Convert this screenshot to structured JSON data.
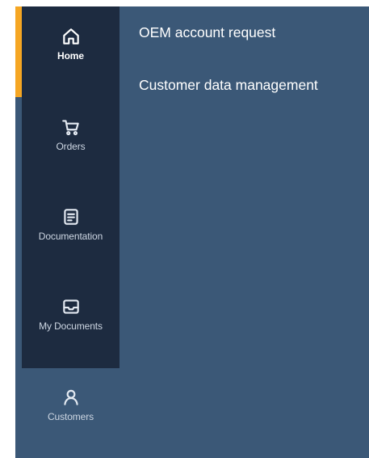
{
  "sidebar": {
    "items": [
      {
        "label": "Home",
        "icon": "home-icon",
        "active": true
      },
      {
        "label": "Orders",
        "icon": "cart-icon",
        "active": false
      },
      {
        "label": "Documentation",
        "icon": "document-icon",
        "active": false
      },
      {
        "label": "My Documents",
        "icon": "inbox-icon",
        "active": false
      },
      {
        "label": "Customers",
        "icon": "user-icon",
        "active": false
      }
    ]
  },
  "submenu": {
    "items": [
      {
        "label": "OEM account request"
      },
      {
        "label": "Customer data management"
      }
    ]
  },
  "colors": {
    "background": "#3b5877",
    "sidebar": "#1d2b40",
    "accent": "#f5a623",
    "text": "#ffffff"
  }
}
